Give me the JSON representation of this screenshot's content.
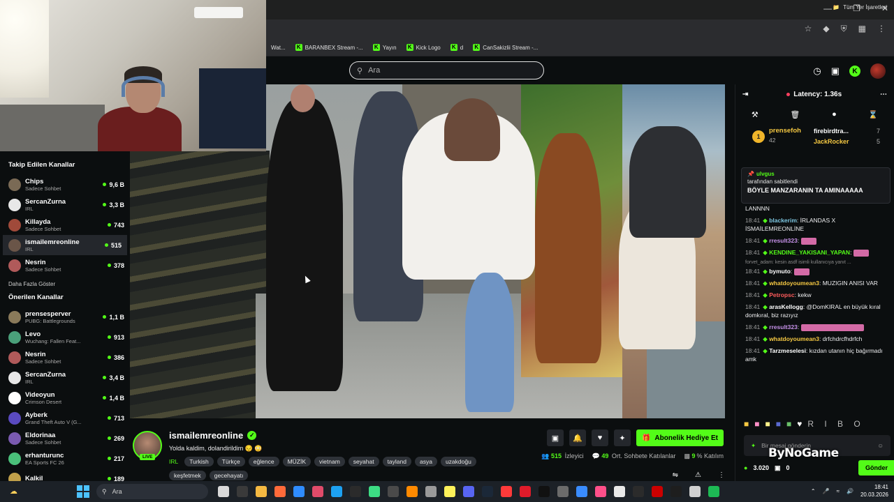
{
  "browser": {
    "bookmarks": [
      {
        "label": "Wat...",
        "icon": "page-icon"
      },
      {
        "label": "BARANBEX Stream -...",
        "icon": "kick-icon"
      },
      {
        "label": "Yayın",
        "icon": "kick-icon"
      },
      {
        "label": "Kick Logo",
        "icon": "kick-icon"
      },
      {
        "label": "d",
        "icon": "kick-icon"
      },
      {
        "label": "CanSakizlii Stream -...",
        "icon": "kick-icon"
      }
    ],
    "all_bookmarks": "Tüm Yer İşaretleri"
  },
  "header": {
    "search_placeholder": "Ara"
  },
  "sidebar": {
    "followed_title": "Takip Edilen Kanallar",
    "followed": [
      {
        "name": "Chips",
        "sub": "Sadece Sohbet",
        "count": "9,6 B",
        "color": "#7a6a55"
      },
      {
        "name": "SercanZurna",
        "sub": "IRL",
        "count": "3,3 B",
        "color": "#e8e8e8"
      },
      {
        "name": "Killayda",
        "sub": "Sadece Sohbet",
        "count": "743",
        "color": "#a04a3a"
      },
      {
        "name": "ismailemreonline",
        "sub": "IRL",
        "count": "515",
        "color": "#6a5548",
        "active": true
      },
      {
        "name": "Nesrin",
        "sub": "Sadece Sohbet",
        "count": "378",
        "color": "#b05a5a"
      }
    ],
    "show_more": "Daha Fazla Göster",
    "recommended_title": "Önerilen Kanallar",
    "recommended": [
      {
        "name": "prensesperver",
        "sub": "PUBG: Battlegrounds",
        "count": "1,1 B",
        "color": "#8a7a5a"
      },
      {
        "name": "Levo",
        "sub": "Wuchang: Fallen Feat...",
        "count": "913",
        "color": "#4aa07a"
      },
      {
        "name": "Nesrin",
        "sub": "Sadece Sohbet",
        "count": "386",
        "color": "#b05a5a"
      },
      {
        "name": "SercanZurna",
        "sub": "IRL",
        "count": "3,4 B",
        "color": "#e8e8e8"
      },
      {
        "name": "Videoyun",
        "sub": "Crimson Desert",
        "count": "1,4 B",
        "color": "#ffffff"
      },
      {
        "name": "Ayberk",
        "sub": "Grand Theft Auto V (G...",
        "count": "713",
        "color": "#5a4ac0"
      },
      {
        "name": "Eldorinaa",
        "sub": "Sadece Sohbet",
        "count": "269",
        "color": "#7a5ab0"
      },
      {
        "name": "erhanturunc",
        "sub": "EA Sports FC 26",
        "count": "217",
        "color": "#4ac07a"
      },
      {
        "name": "Kalkil",
        "sub": "",
        "count": "189",
        "color": "#c0a04a"
      }
    ]
  },
  "stream": {
    "channel": "ismailemreonline",
    "live": "LIVE",
    "title": "Yolda kaldim, dolandirildim 😔 😳",
    "category": "IRL",
    "tags": [
      "Turkish",
      "Türkçe",
      "eğlence",
      "MÜZİK",
      "vietnam",
      "seyahat",
      "tayland",
      "asya",
      "uzakdoğu",
      "keşfetmek",
      "gecehayatı"
    ],
    "gift_button": "Abonelik Hediye Et",
    "viewers": "515",
    "viewers_label": "İzleyici",
    "avg_chatters": "49",
    "avg_label": "Ort. Sohbete Katılanlar",
    "participation": "9",
    "participation_label": "% Katılım"
  },
  "chat": {
    "latency": "Latency: 1.36s",
    "leaderboard": {
      "first": {
        "name": "prensefoh",
        "value": "42"
      },
      "second": {
        "name": "firebirdtra...",
        "value": "7"
      },
      "third": {
        "name": "JackRocker",
        "value": "5"
      }
    },
    "pinned": {
      "user": "ulvgus",
      "pinned_by": "tarafından sabitlendi",
      "message": "BÖYLE MANZARANIN TA AMINAAAAA"
    },
    "overflow_text": "LANNNN",
    "messages": [
      {
        "time": "18:41",
        "user": "blackerim",
        "color": "#7ec8e3",
        "text": "İRLANDAS X İSMAİLEMREONLİNE"
      },
      {
        "time": "18:41",
        "user": "rresult323",
        "color": "#c792ea",
        "text": ""
      },
      {
        "time": "18:41",
        "user": "KENDINE_YAKISANI_YAPAN",
        "color": "#53fc18",
        "text": ""
      },
      {
        "time": "18:41",
        "user": "bymuto",
        "color": "#ffffff",
        "text": "",
        "reply": "forvet_adam: kesin asdf isimli kullanıcıya yanıt ..."
      },
      {
        "time": "18:41",
        "user": "whatdoyoumean3",
        "color": "#f5c842",
        "text": "MUZIGIN ANISI VAR"
      },
      {
        "time": "18:41",
        "user": "Petropsc",
        "color": "#ff5c5c",
        "text": "kekw"
      },
      {
        "time": "18:41",
        "user": "arasKellogg",
        "color": "#ffffff",
        "text": "@DomKIRAL en büyük kıral domkıral, biz razıyız"
      },
      {
        "time": "18:41",
        "user": "rresult323",
        "color": "#c792ea",
        "text": ""
      },
      {
        "time": "18:41",
        "user": "whatdoyoumean3",
        "color": "#f5c842",
        "text": "drfchdrcfhdrfch"
      },
      {
        "time": "18:41",
        "user": "Tarzmeselesi",
        "color": "#ffffff",
        "text": "kızdan utanın hiç bağırmadı amk"
      }
    ],
    "emote_row": "R I B O",
    "input_placeholder": "Bir mesaj gönderin",
    "points": "3.020",
    "zero": "0",
    "send": "Gönder"
  },
  "watermark": "ByNoGame",
  "taskbar": {
    "search_placeholder": "Ara",
    "time": "18:41",
    "date": "20.03.2026"
  }
}
